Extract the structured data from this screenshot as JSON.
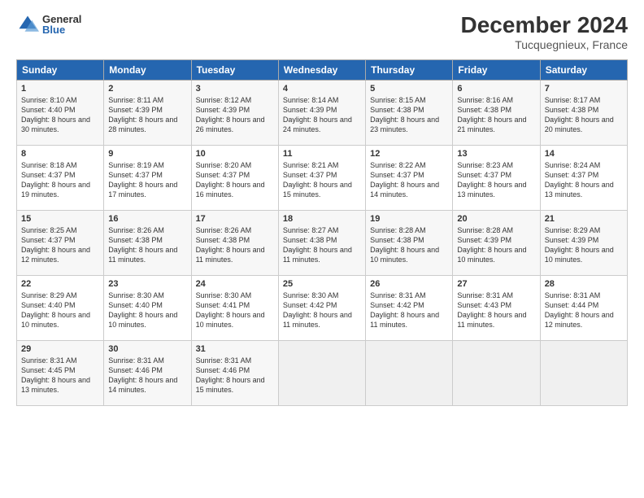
{
  "logo": {
    "general": "General",
    "blue": "Blue"
  },
  "header": {
    "month": "December 2024",
    "location": "Tucquegnieux, France"
  },
  "weekdays": [
    "Sunday",
    "Monday",
    "Tuesday",
    "Wednesday",
    "Thursday",
    "Friday",
    "Saturday"
  ],
  "weeks": [
    [
      {
        "day": "1",
        "sunrise": "8:10 AM",
        "sunset": "4:40 PM",
        "daylight": "8 hours and 30 minutes."
      },
      {
        "day": "2",
        "sunrise": "8:11 AM",
        "sunset": "4:39 PM",
        "daylight": "8 hours and 28 minutes."
      },
      {
        "day": "3",
        "sunrise": "8:12 AM",
        "sunset": "4:39 PM",
        "daylight": "8 hours and 26 minutes."
      },
      {
        "day": "4",
        "sunrise": "8:14 AM",
        "sunset": "4:39 PM",
        "daylight": "8 hours and 24 minutes."
      },
      {
        "day": "5",
        "sunrise": "8:15 AM",
        "sunset": "4:38 PM",
        "daylight": "8 hours and 23 minutes."
      },
      {
        "day": "6",
        "sunrise": "8:16 AM",
        "sunset": "4:38 PM",
        "daylight": "8 hours and 21 minutes."
      },
      {
        "day": "7",
        "sunrise": "8:17 AM",
        "sunset": "4:38 PM",
        "daylight": "8 hours and 20 minutes."
      }
    ],
    [
      {
        "day": "8",
        "sunrise": "8:18 AM",
        "sunset": "4:37 PM",
        "daylight": "8 hours and 19 minutes."
      },
      {
        "day": "9",
        "sunrise": "8:19 AM",
        "sunset": "4:37 PM",
        "daylight": "8 hours and 17 minutes."
      },
      {
        "day": "10",
        "sunrise": "8:20 AM",
        "sunset": "4:37 PM",
        "daylight": "8 hours and 16 minutes."
      },
      {
        "day": "11",
        "sunrise": "8:21 AM",
        "sunset": "4:37 PM",
        "daylight": "8 hours and 15 minutes."
      },
      {
        "day": "12",
        "sunrise": "8:22 AM",
        "sunset": "4:37 PM",
        "daylight": "8 hours and 14 minutes."
      },
      {
        "day": "13",
        "sunrise": "8:23 AM",
        "sunset": "4:37 PM",
        "daylight": "8 hours and 13 minutes."
      },
      {
        "day": "14",
        "sunrise": "8:24 AM",
        "sunset": "4:37 PM",
        "daylight": "8 hours and 13 minutes."
      }
    ],
    [
      {
        "day": "15",
        "sunrise": "8:25 AM",
        "sunset": "4:37 PM",
        "daylight": "8 hours and 12 minutes."
      },
      {
        "day": "16",
        "sunrise": "8:26 AM",
        "sunset": "4:38 PM",
        "daylight": "8 hours and 11 minutes."
      },
      {
        "day": "17",
        "sunrise": "8:26 AM",
        "sunset": "4:38 PM",
        "daylight": "8 hours and 11 minutes."
      },
      {
        "day": "18",
        "sunrise": "8:27 AM",
        "sunset": "4:38 PM",
        "daylight": "8 hours and 11 minutes."
      },
      {
        "day": "19",
        "sunrise": "8:28 AM",
        "sunset": "4:38 PM",
        "daylight": "8 hours and 10 minutes."
      },
      {
        "day": "20",
        "sunrise": "8:28 AM",
        "sunset": "4:39 PM",
        "daylight": "8 hours and 10 minutes."
      },
      {
        "day": "21",
        "sunrise": "8:29 AM",
        "sunset": "4:39 PM",
        "daylight": "8 hours and 10 minutes."
      }
    ],
    [
      {
        "day": "22",
        "sunrise": "8:29 AM",
        "sunset": "4:40 PM",
        "daylight": "8 hours and 10 minutes."
      },
      {
        "day": "23",
        "sunrise": "8:30 AM",
        "sunset": "4:40 PM",
        "daylight": "8 hours and 10 minutes."
      },
      {
        "day": "24",
        "sunrise": "8:30 AM",
        "sunset": "4:41 PM",
        "daylight": "8 hours and 10 minutes."
      },
      {
        "day": "25",
        "sunrise": "8:30 AM",
        "sunset": "4:42 PM",
        "daylight": "8 hours and 11 minutes."
      },
      {
        "day": "26",
        "sunrise": "8:31 AM",
        "sunset": "4:42 PM",
        "daylight": "8 hours and 11 minutes."
      },
      {
        "day": "27",
        "sunrise": "8:31 AM",
        "sunset": "4:43 PM",
        "daylight": "8 hours and 11 minutes."
      },
      {
        "day": "28",
        "sunrise": "8:31 AM",
        "sunset": "4:44 PM",
        "daylight": "8 hours and 12 minutes."
      }
    ],
    [
      {
        "day": "29",
        "sunrise": "8:31 AM",
        "sunset": "4:45 PM",
        "daylight": "8 hours and 13 minutes."
      },
      {
        "day": "30",
        "sunrise": "8:31 AM",
        "sunset": "4:46 PM",
        "daylight": "8 hours and 14 minutes."
      },
      {
        "day": "31",
        "sunrise": "8:31 AM",
        "sunset": "4:46 PM",
        "daylight": "8 hours and 15 minutes."
      },
      null,
      null,
      null,
      null
    ]
  ]
}
